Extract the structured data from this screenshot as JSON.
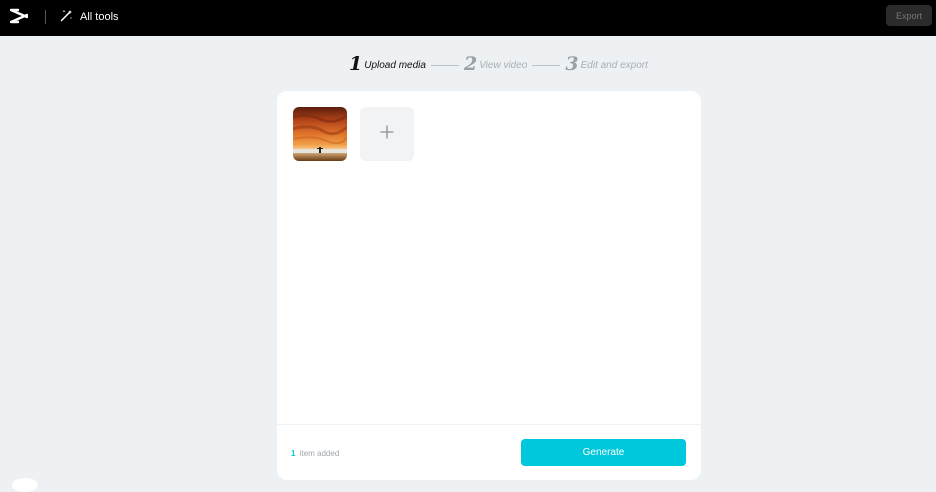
{
  "header": {
    "logo_icon": "capcut-logo-icon",
    "all_tools_icon": "magic-wand-icon",
    "all_tools_label": "All tools",
    "export_label": "Export"
  },
  "stepper": {
    "steps": [
      {
        "number": "1",
        "label": "Upload media",
        "state": "active"
      },
      {
        "number": "2",
        "label": "View video",
        "state": "inactive"
      },
      {
        "number": "3",
        "label": "Edit and export",
        "state": "inactive"
      }
    ]
  },
  "upload": {
    "media_thumbnail_icon": "sunset-image-thumbnail",
    "add_icon": "plus-icon",
    "count_number": "1",
    "count_text": "item added",
    "generate_label": "Generate"
  },
  "colors": {
    "accent": "#00c8dc",
    "topbar": "#000000",
    "page_bg": "#eef1f3"
  }
}
